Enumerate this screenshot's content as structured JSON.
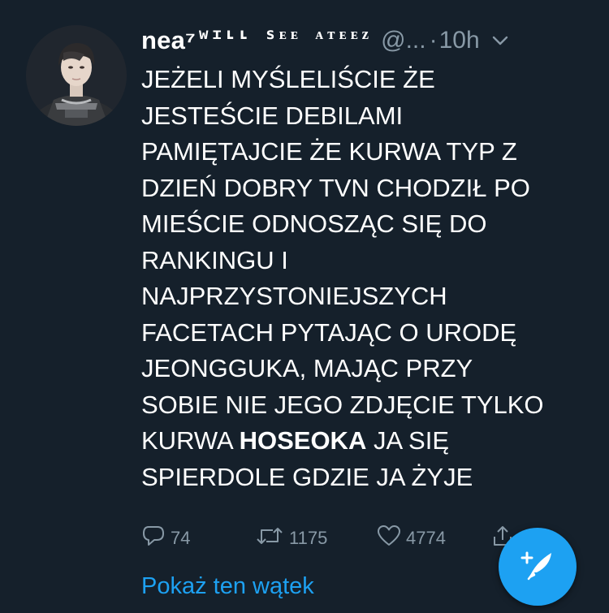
{
  "tweet": {
    "display_name": "nea⁷",
    "name_decoration": "wɪʟʟ sᴇᴇ ᴀᴛᴇᴇᴢ",
    "handle": "@...",
    "separator": "·",
    "time": "10h",
    "body_before": "JEŻELI MYŚLELIŚCIE ŻE\nJESTEŚCIE DEBILAMI\nPAMIĘTAJCIE ŻE KURWA TYP Z\nDZIEŃ DOBRY TVN CHODZIŁ PO\nMIEŚCIE ODNOSZĄC SIĘ DO\nRANKINGU I\nNAJPRZYSTONIEJSZYCH\nFACETACH PYTAJĄC O URODĘ\nJEONGGUKA, MAJĄC PRZY\nSOBIE NIE JEGO ZDJĘCIE TYLKO\nKURWA ",
    "body_bold": "HOSEOKA",
    "body_after": " JA SIĘ\nSPIERDOLE GDZIE JA ŻYJE"
  },
  "actions": {
    "reply_count": "74",
    "retweet_count": "1175",
    "like_count": "4774"
  },
  "thread_link": "Pokaż ten wątek",
  "icons": {
    "avatar": "avatar-photo",
    "chevron": "chevron-down-icon",
    "reply": "reply-icon",
    "retweet": "retweet-icon",
    "like": "heart-icon",
    "share": "share-icon",
    "compose": "compose-tweet-icon"
  },
  "colors": {
    "background": "#15202b",
    "text": "#ffffff",
    "secondary": "#8899a6",
    "accent": "#1da1f2"
  }
}
